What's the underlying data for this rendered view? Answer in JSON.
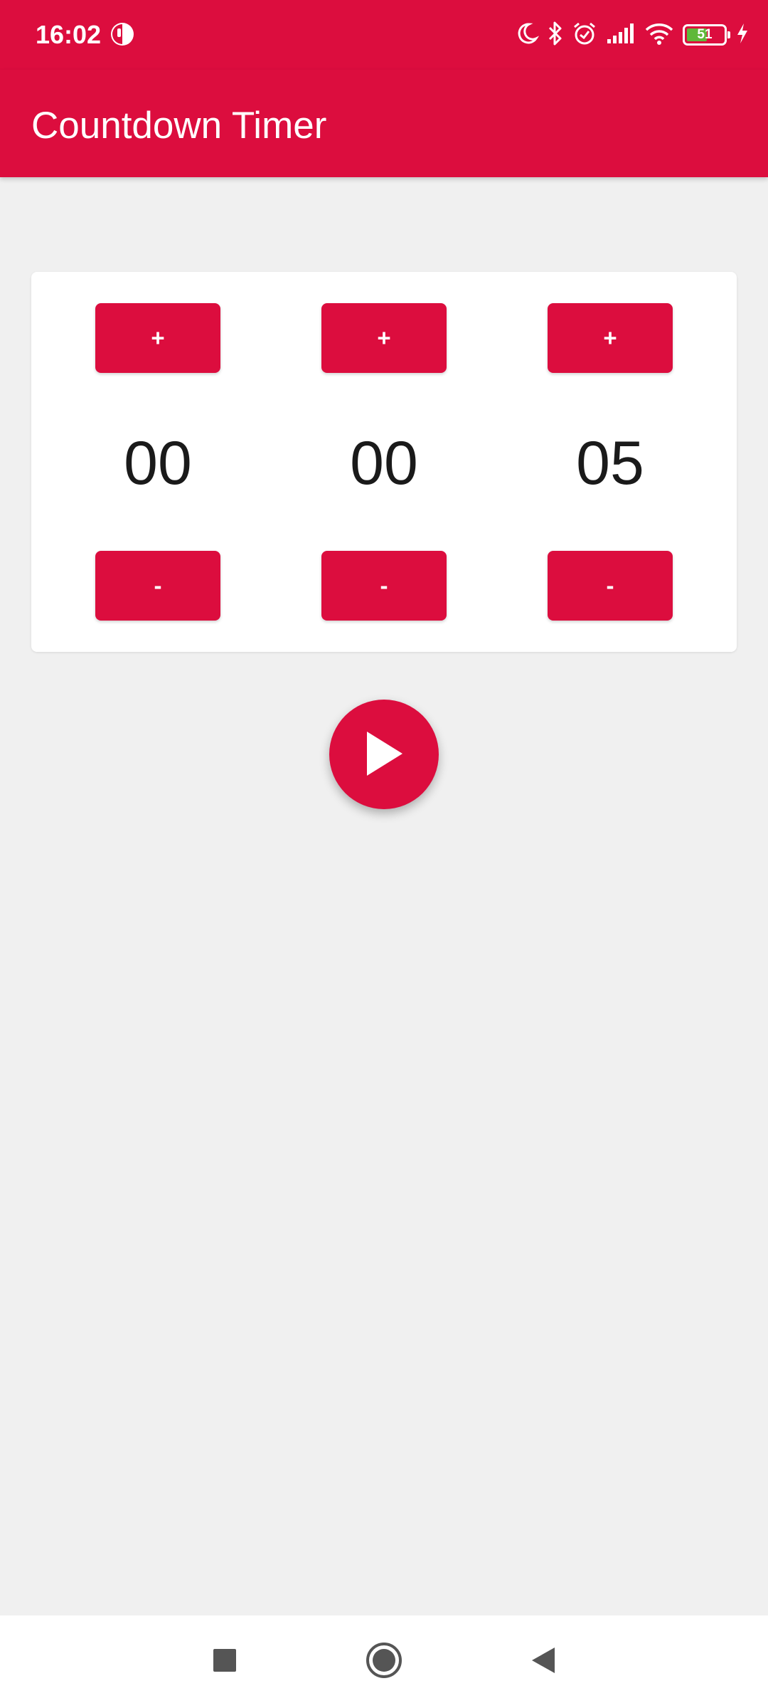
{
  "status_bar": {
    "time": "16:02",
    "battery_level": "51",
    "icons": [
      "app-notification-icon",
      "moon-icon",
      "bluetooth-icon",
      "alarm-icon",
      "signal-icon",
      "wifi-icon",
      "battery-icon",
      "charging-icon"
    ]
  },
  "app_bar": {
    "title": "Countdown Timer"
  },
  "timer": {
    "hours": "00",
    "minutes": "00",
    "seconds": "05",
    "increment_label": "+",
    "decrement_label": "-"
  },
  "controls": {
    "play_icon": "play-icon"
  },
  "nav_bar": {
    "icons": [
      "recents-icon",
      "home-icon",
      "back-icon"
    ]
  },
  "colors": {
    "accent": "#dc0d3e",
    "background": "#f0f0f0",
    "card": "#ffffff",
    "digit_text": "#1a1a1a"
  }
}
